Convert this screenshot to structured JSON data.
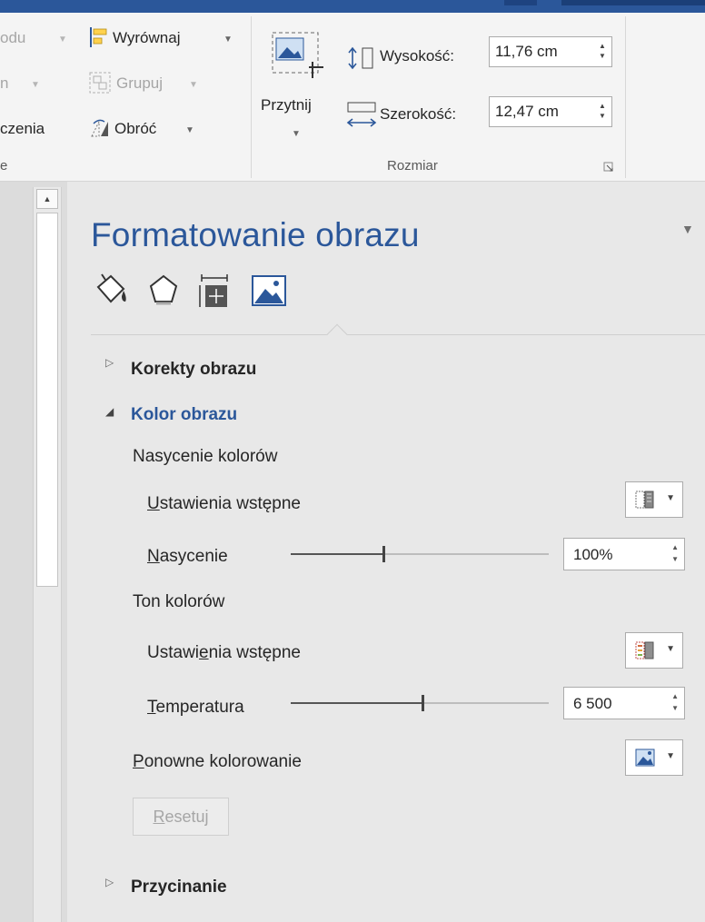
{
  "ribbon": {
    "arrange_group": {
      "row1_partial": "odu",
      "row2_partial": "n",
      "row3_partial": "czenia",
      "align_label": "Wyrównaj",
      "group_label": "Grupuj",
      "rotate_label": "Obróć",
      "group_footer": "e"
    },
    "size_group": {
      "crop_label": "Przytnij",
      "height_label": "Wysokość:",
      "height_value": "11,76 cm",
      "width_label": "Szerokość:",
      "width_value": "12,47 cm",
      "footer": "Rozmiar"
    }
  },
  "pane": {
    "title": "Formatowanie obrazu",
    "tabs": [
      "fill-line-tab",
      "effects-tab",
      "layout-properties-tab",
      "picture-tab"
    ],
    "sections": {
      "corrections": "Korekty obrazu",
      "color": "Kolor obrazu",
      "crop": "Przycinanie"
    },
    "saturation": {
      "heading": "Nasycenie kolorów",
      "presets_label_u": "U",
      "presets_label_rest": "stawienia wstępne",
      "slider_label_u": "N",
      "slider_label_rest": "asycenie",
      "value": "100%",
      "slider_fraction": 0.36
    },
    "tone": {
      "heading": "Ton kolorów",
      "presets_label_pre": "Ustawi",
      "presets_label_u": "e",
      "presets_label_post": "nia wstępne",
      "slider_label_u": "T",
      "slider_label_rest": "emperatura",
      "value": "6 500",
      "slider_fraction": 0.51
    },
    "recolor": {
      "label_u": "P",
      "label_rest": "onowne kolorowanie"
    },
    "reset": {
      "label_u": "R",
      "label_rest": "esetuj"
    }
  },
  "colors": {
    "accent": "#2b579a",
    "pane_bg": "#e8e8e8",
    "ribbon_bg": "#f4f4f4"
  }
}
